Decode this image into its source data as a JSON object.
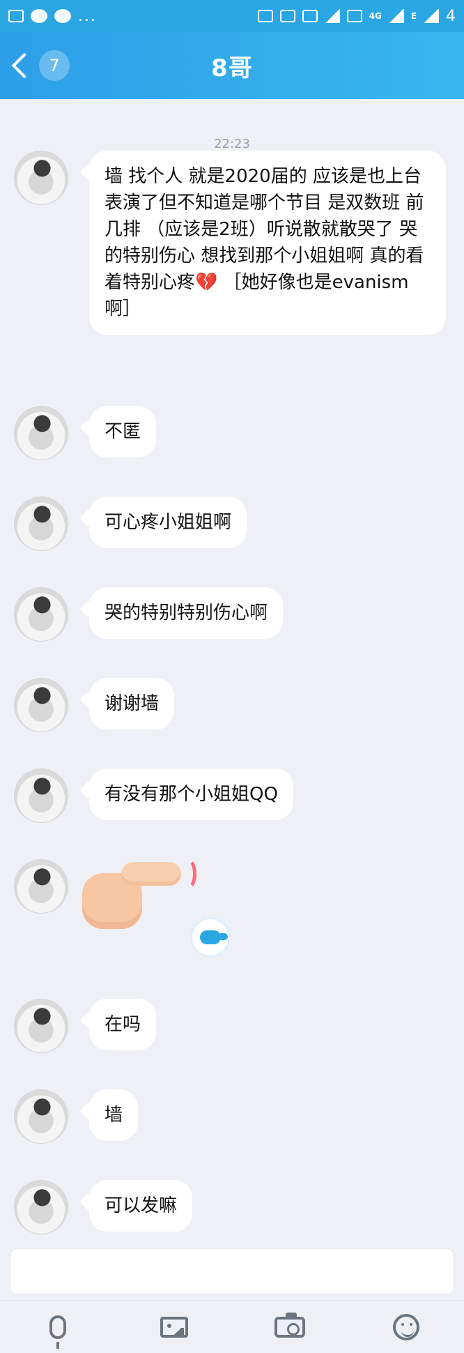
{
  "status_bar": {
    "left_icons": [
      "image-icon",
      "wechat-icon",
      "wechat-icon",
      "more-icon"
    ],
    "right_text": "4"
  },
  "header": {
    "back_badge": "7",
    "title": "8哥"
  },
  "chat": {
    "timestamp": "22:23",
    "messages": [
      {
        "text": "墙 找个人 就是2020届的 应该是也上台表演了但不知道是哪个节目 是双数班 前几排 （应该是2班）听说散就散哭了 哭的特别伤心 想找到那个小姐姐啊 真的看着特别心疼💔 ［她好像也是evanism啊］"
      },
      {
        "text": "不匿"
      },
      {
        "text": "可心疼小姐姐啊"
      },
      {
        "text": "哭的特别特别伤心啊"
      },
      {
        "text": "谢谢墙"
      },
      {
        "text": "有没有那个小姐姐QQ"
      },
      {
        "text": ""
      },
      {
        "text": "在吗"
      },
      {
        "text": "墙"
      },
      {
        "text": "可以发嘛"
      }
    ]
  },
  "composer": {
    "placeholder": ""
  },
  "bottom_bar": {
    "tools": [
      "microphone-icon",
      "image-icon",
      "camera-icon",
      "emoji-icon"
    ]
  },
  "colors": {
    "status_bar": "#2aa6e3",
    "header_start": "#2d9fe9",
    "header_end": "#39b7ec",
    "bubble": "#ffffff",
    "background": "#eef0f5",
    "text": "#111111",
    "timestamp": "#9aa0aa",
    "icon": "#6c7480"
  }
}
